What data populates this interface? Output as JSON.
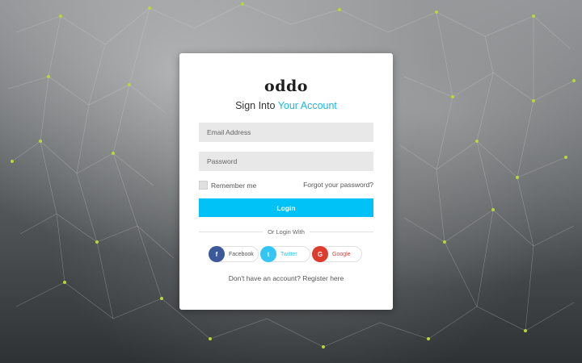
{
  "brand": {
    "logo": "oddo"
  },
  "heading": {
    "prefix": "Sign Into",
    "accent": "Your Account"
  },
  "form": {
    "email_placeholder": "Email Address",
    "password_placeholder": "Password",
    "remember_label": "Remember me",
    "forgot_label": "Forgot your password?",
    "login_label": "Login"
  },
  "social": {
    "divider_label": "Or Login With",
    "facebook": {
      "label": "Facebook",
      "icon": "f"
    },
    "twitter": {
      "label": "Twitter",
      "icon": "t"
    },
    "google": {
      "label": "Google",
      "icon": "G"
    }
  },
  "footer": {
    "question": "Don't have an account?",
    "register_label": "Register here"
  },
  "colors": {
    "accent": "#00c2f7",
    "facebook": "#3b5998",
    "twitter": "#33c6f4",
    "google": "#dd3b2e",
    "network_dots": "#b6d83a"
  }
}
